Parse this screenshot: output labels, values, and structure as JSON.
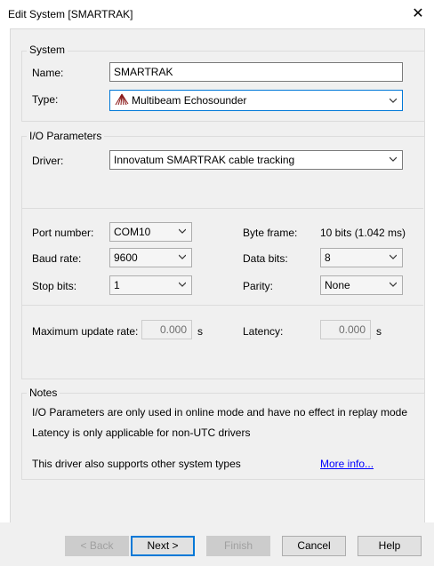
{
  "window": {
    "title": "Edit System [SMARTRAK]",
    "close_glyph": "✕"
  },
  "system_group": {
    "legend": "System",
    "name_label": "Name:",
    "name_value": "SMARTRAK",
    "type_label": "Type:",
    "type_value": "Multibeam Echosounder",
    "type_icon": "multibeam-icon"
  },
  "io_group": {
    "legend": "I/O Parameters",
    "driver_label": "Driver:",
    "driver_value": "Innovatum SMARTRAK cable tracking",
    "port_label": "Port number:",
    "port_value": "COM10",
    "baud_label": "Baud rate:",
    "baud_value": "9600",
    "stop_label": "Stop bits:",
    "stop_value": "1",
    "byteframe_label": "Byte frame:",
    "byteframe_value": "10 bits (1.042 ms)",
    "databits_label": "Data bits:",
    "databits_value": "8",
    "parity_label": "Parity:",
    "parity_value": "None",
    "maxrate_label": "Maximum update rate:",
    "maxrate_value": "0.000",
    "maxrate_unit": "s",
    "latency_label": "Latency:",
    "latency_value": "0.000",
    "latency_unit": "s"
  },
  "notes_group": {
    "legend": "Notes",
    "line1": "I/O Parameters are only used in online mode and have no effect in replay mode",
    "line2": "Latency is only applicable for non-UTC drivers",
    "line3": "This driver also supports other system types",
    "more_info": "More info..."
  },
  "footer": {
    "back": "< Back",
    "next": "Next >",
    "finish": "Finish",
    "cancel": "Cancel",
    "help": "Help"
  }
}
